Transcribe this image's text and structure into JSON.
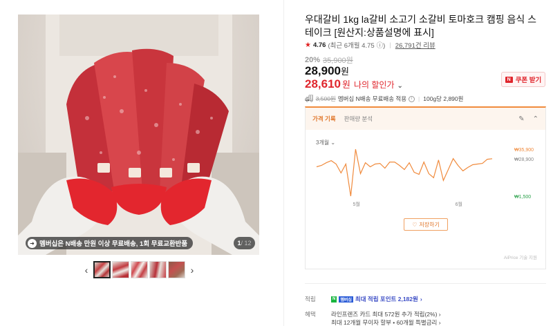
{
  "product": {
    "title": "우대갈비 1kg la갈비 소고기 소갈비 토마호크 캠핑 음식 스테이크 [원산지:상품설명에 표시]",
    "rating": "4.76",
    "rating_recent": "(최근 6개월 4.75",
    "review_count": "26,791건 리뷰",
    "discount_pct": "20%",
    "original_price": "35,900원",
    "price": "28,900",
    "price_unit": "원",
    "sale_price": "28,610",
    "sale_unit": "원",
    "sale_label": "나의 할인가",
    "coupon_label": "쿠폰 받기",
    "shipping_old": "3,500원",
    "shipping_text": "멤버십 N배송 무료배송 적용",
    "unit_price": "100g당 2,890원"
  },
  "gallery": {
    "badge_text": "멤버십은 N배송 만원 이상 무료배송, 1회 무료교환반품",
    "current": "1",
    "total": "/ 12",
    "thumb_count": 5
  },
  "history": {
    "tab_active": "가격 기록",
    "tab_other": "판매량 분석",
    "period": "3개월",
    "save_label": "저장하기",
    "footer": "AiPrice 기술 지원"
  },
  "chart_data": {
    "type": "line",
    "title": "",
    "x_ticks": [
      "5월",
      "6월"
    ],
    "y_labels": [
      "₩35,900",
      "₩28,900",
      "₩1,500"
    ],
    "ylim": [
      1500,
      35900
    ],
    "series": [
      {
        "name": "",
        "values": [
          23000,
          24000,
          26000,
          27500,
          25000,
          18500,
          25000,
          1500,
          35900,
          18000,
          26000,
          23000,
          25000,
          25500,
          22000,
          26500,
          26500,
          24000,
          21000,
          26000,
          19000,
          17500,
          26500,
          18000,
          15000,
          28000,
          13000,
          21000,
          29000,
          24000,
          20000,
          22500,
          24500,
          25000,
          25500,
          28500,
          28900
        ]
      }
    ],
    "grid": false,
    "legend": "none"
  },
  "benefits": {
    "point_label": "적립",
    "point_badge_n": "N",
    "point_badge_m": "멤버십",
    "point_text": "최대 적립 포인트 2,182원",
    "benefit_label": "혜택",
    "benefit_line1": "라인프렌즈 카드 최대 572원 추가 적립(2%)",
    "benefit_line2": "최대 12개월 무이자 할부 • 60개월 특별금리"
  },
  "colors": {
    "accent_red": "#e0262d",
    "accent_orange": "#f08a3c",
    "low_green": "#2aa14a"
  }
}
